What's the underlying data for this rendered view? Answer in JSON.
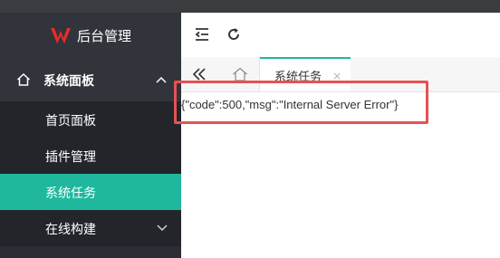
{
  "brand": {
    "title": "后台管理",
    "logo_icon": "w-logo-icon",
    "logo_color": "#e62b2b"
  },
  "sidebar": {
    "group": {
      "label": "系统面板",
      "icon": "home-icon",
      "expanded": true
    },
    "items": [
      {
        "label": "首页面板",
        "active": false
      },
      {
        "label": "插件管理",
        "active": false
      },
      {
        "label": "系统任务",
        "active": true
      },
      {
        "label": "在线构建",
        "active": false,
        "has_children": true
      }
    ],
    "active_color": "#1fb89e"
  },
  "header": {
    "buttons": [
      {
        "icon": "collapse-menu-icon"
      },
      {
        "icon": "refresh-icon"
      }
    ]
  },
  "tabs": {
    "scroll_icon": "double-chevron-left-icon",
    "home_icon": "home-icon",
    "items": [
      {
        "label": "系统任务",
        "active": true,
        "closable": true,
        "close_glyph": "×"
      }
    ]
  },
  "content": {
    "text": "{\"code\":500,\"msg\":\"Internal Server Error\"}"
  },
  "annotation": {
    "color": "#e65252"
  }
}
